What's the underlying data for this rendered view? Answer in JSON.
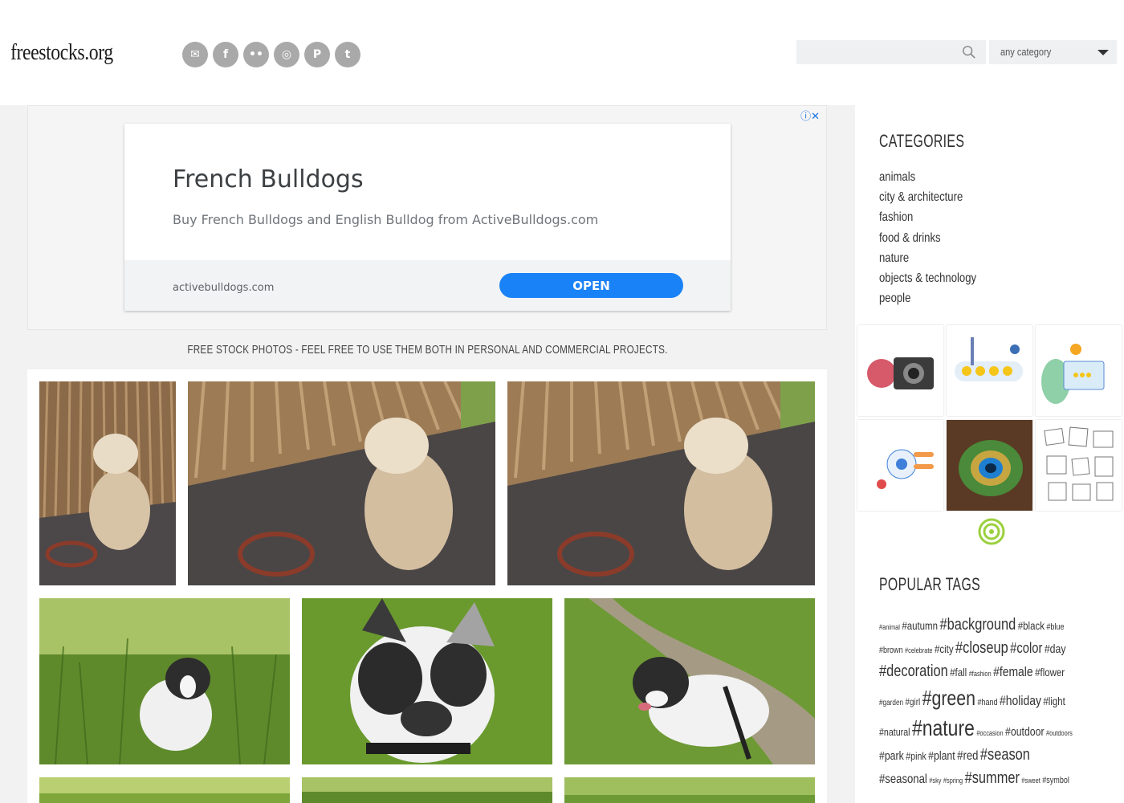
{
  "header": {
    "logo": "freestocks.org",
    "social": [
      {
        "icon": "email-icon",
        "glyph": "✉"
      },
      {
        "icon": "facebook-icon",
        "glyph": "f"
      },
      {
        "icon": "flickr-icon",
        "glyph": "••"
      },
      {
        "icon": "instagram-icon",
        "glyph": "◎"
      },
      {
        "icon": "pinterest-icon",
        "glyph": "P"
      },
      {
        "icon": "twitter-icon",
        "glyph": "t"
      }
    ],
    "search_value": "",
    "category_selected": "any category"
  },
  "ad": {
    "title": "French Bulldogs",
    "description": "Buy French Bulldogs and English Bulldog from ActiveBulldogs.com",
    "domain": "activebulldogs.com",
    "cta": "OPEN"
  },
  "tagline": "FREE STOCK PHOTOS - FEEL FREE TO USE THEM BOTH IN PERSONAL AND COMMERCIAL PROJECTS.",
  "sidebar": {
    "categories_heading": "CATEGORIES",
    "categories": [
      "animals",
      "city & architecture",
      "fashion",
      "food & drinks",
      "nature",
      "objects & technology",
      "people"
    ],
    "tags_heading": "POPULAR TAGS",
    "tag_lines": [
      [
        {
          "t": "#animal",
          "s": 9
        },
        {
          "t": "#autumn",
          "s": 14
        },
        {
          "t": "#background",
          "s": 20
        },
        {
          "t": "#black",
          "s": 14
        },
        {
          "t": "#blue",
          "s": 11
        }
      ],
      [
        {
          "t": "#brown",
          "s": 11
        },
        {
          "t": "#celebrate",
          "s": 9
        },
        {
          "t": "#city",
          "s": 14
        },
        {
          "t": "#closeup",
          "s": 20
        },
        {
          "t": "#color",
          "s": 18
        },
        {
          "t": "#day",
          "s": 15
        }
      ],
      [
        {
          "t": "#decoration",
          "s": 20
        },
        {
          "t": "#fall",
          "s": 14
        },
        {
          "t": "#fashion",
          "s": 9
        },
        {
          "t": "#female",
          "s": 17
        },
        {
          "t": "#flower",
          "s": 14
        }
      ],
      [
        {
          "t": "#garden",
          "s": 10
        },
        {
          "t": "#girl",
          "s": 12
        },
        {
          "t": "#green",
          "s": 26
        },
        {
          "t": "#hand",
          "s": 11
        },
        {
          "t": "#holiday",
          "s": 17
        },
        {
          "t": "#light",
          "s": 14
        }
      ],
      [
        {
          "t": "#natural",
          "s": 13
        },
        {
          "t": "#nature",
          "s": 28
        },
        {
          "t": "#occasion",
          "s": 9
        },
        {
          "t": "#outdoor",
          "s": 15
        },
        {
          "t": "#outdoors",
          "s": 9
        }
      ],
      [
        {
          "t": "#park",
          "s": 15
        },
        {
          "t": "#pink",
          "s": 13
        },
        {
          "t": "#plant",
          "s": 15
        },
        {
          "t": "#red",
          "s": 16
        },
        {
          "t": "#season",
          "s": 20
        }
      ],
      [
        {
          "t": "#seasonal",
          "s": 16
        },
        {
          "t": "#sky",
          "s": 9
        },
        {
          "t": "#spring",
          "s": 9
        },
        {
          "t": "#summer",
          "s": 20
        },
        {
          "t": "#sweet",
          "s": 9
        },
        {
          "t": "#symbol",
          "s": 11
        }
      ]
    ]
  },
  "colors": {
    "accent": "#1a82f7",
    "social_bg": "#a9a9a9",
    "main_bg": "#f2f2f2"
  }
}
